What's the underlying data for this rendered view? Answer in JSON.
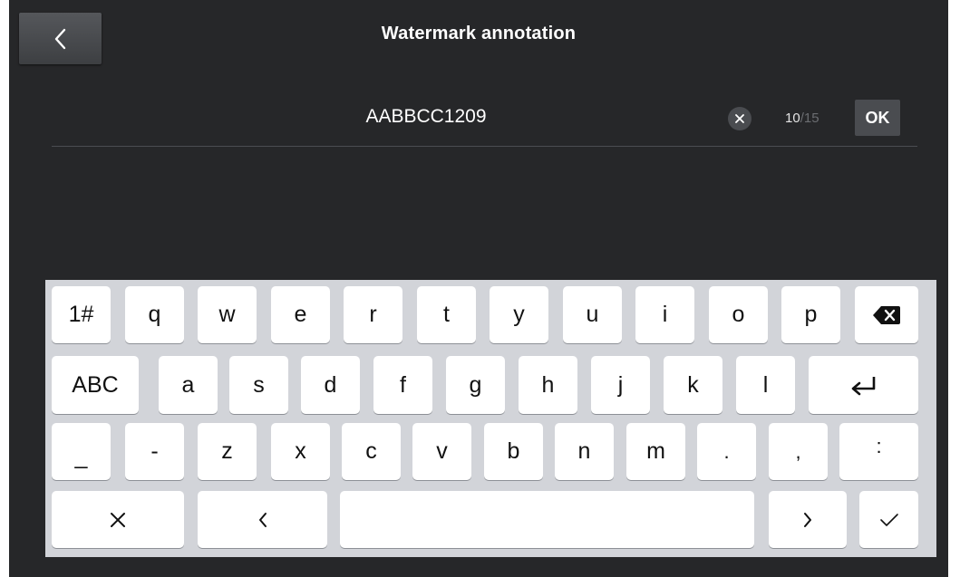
{
  "header": {
    "title": "Watermark annotation"
  },
  "input": {
    "value": "AABBCC1209",
    "counter_current": "10",
    "counter_max": "/15",
    "ok_label": "OK"
  },
  "keyboard": {
    "row1": [
      "1#",
      "q",
      "w",
      "e",
      "r",
      "t",
      "y",
      "u",
      "i",
      "o",
      "p"
    ],
    "row2": [
      "ABC",
      "a",
      "s",
      "d",
      "f",
      "g",
      "h",
      "j",
      "k",
      "l"
    ],
    "row3": [
      "_",
      "-",
      "z",
      "x",
      "c",
      "v",
      "b",
      "n",
      "m",
      ".",
      ",",
      ":"
    ],
    "icons": {
      "backspace": "backspace-icon",
      "enter": "enter-icon",
      "close": "close-icon",
      "cursor_left": "chevron-left-icon",
      "cursor_right": "chevron-right-icon",
      "confirm": "checkmark-icon"
    }
  },
  "colors": {
    "background": "#262729",
    "keyboard_bg": "#d2d4d9",
    "key_bg": "#ffffff",
    "button_bg": "#4a4c50"
  }
}
